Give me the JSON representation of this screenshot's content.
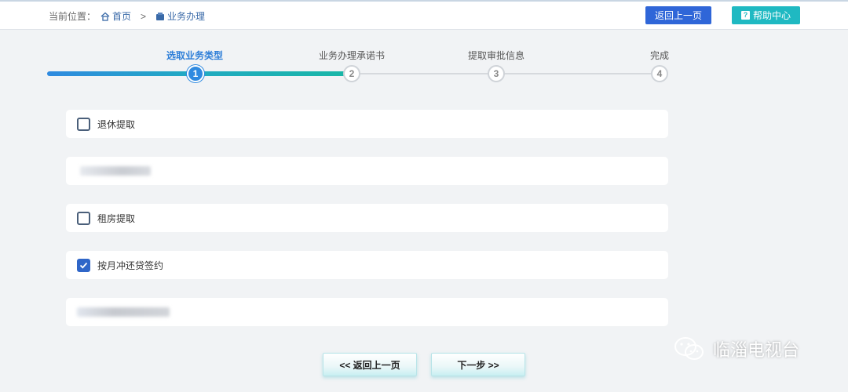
{
  "header": {
    "breadcrumb_prefix": "当前位置：",
    "crumb_home": "首页",
    "crumb_sep": ">",
    "crumb_current": "业务办理",
    "back_button": "返回上一页",
    "help_button": "帮助中心"
  },
  "stepper": {
    "current_step": 1,
    "steps": [
      {
        "label": "选取业务类型",
        "num": "1"
      },
      {
        "label": "业务办理承诺书",
        "num": "2"
      },
      {
        "label": "提取审批信息",
        "num": "3"
      },
      {
        "label": "完成",
        "num": "4"
      }
    ]
  },
  "options": [
    {
      "label": "退休提取",
      "checked": false
    },
    {
      "label": "",
      "checked": false
    },
    {
      "label": "租房提取",
      "checked": false
    },
    {
      "label": "按月冲还贷签约",
      "checked": true
    },
    {
      "label": "",
      "checked": false
    }
  ],
  "footer": {
    "prev_button": "<< 返回上一页",
    "next_button": "下一步 >>"
  },
  "watermark": {
    "text": "临淄电视台"
  },
  "colors": {
    "primary_blue": "#2f66d8",
    "teal": "#1fb9c2",
    "step_active": "#2f8ae0"
  }
}
